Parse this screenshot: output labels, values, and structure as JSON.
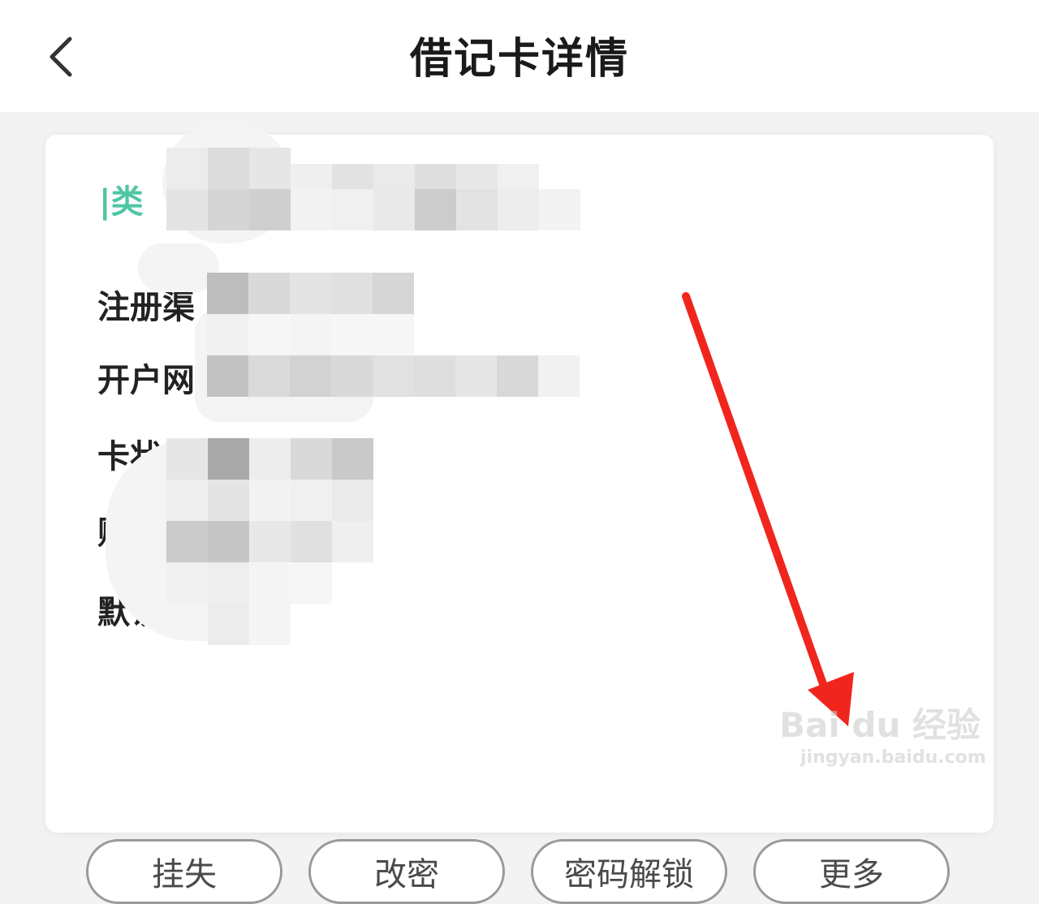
{
  "header": {
    "title": "借记卡详情"
  },
  "card": {
    "type_label": "|类",
    "info_rows": [
      "注册渠",
      "开户网",
      "卡状",
      "账",
      "默认账"
    ]
  },
  "actions": [
    "挂失",
    "改密",
    "密码解锁",
    "更多"
  ],
  "watermark": {
    "brand": "Bai du 经验",
    "url": "jingyan.baidu.com"
  },
  "colors": {
    "accent_green": "#4fc6a4",
    "annotation_arrow": "#f0261e"
  }
}
